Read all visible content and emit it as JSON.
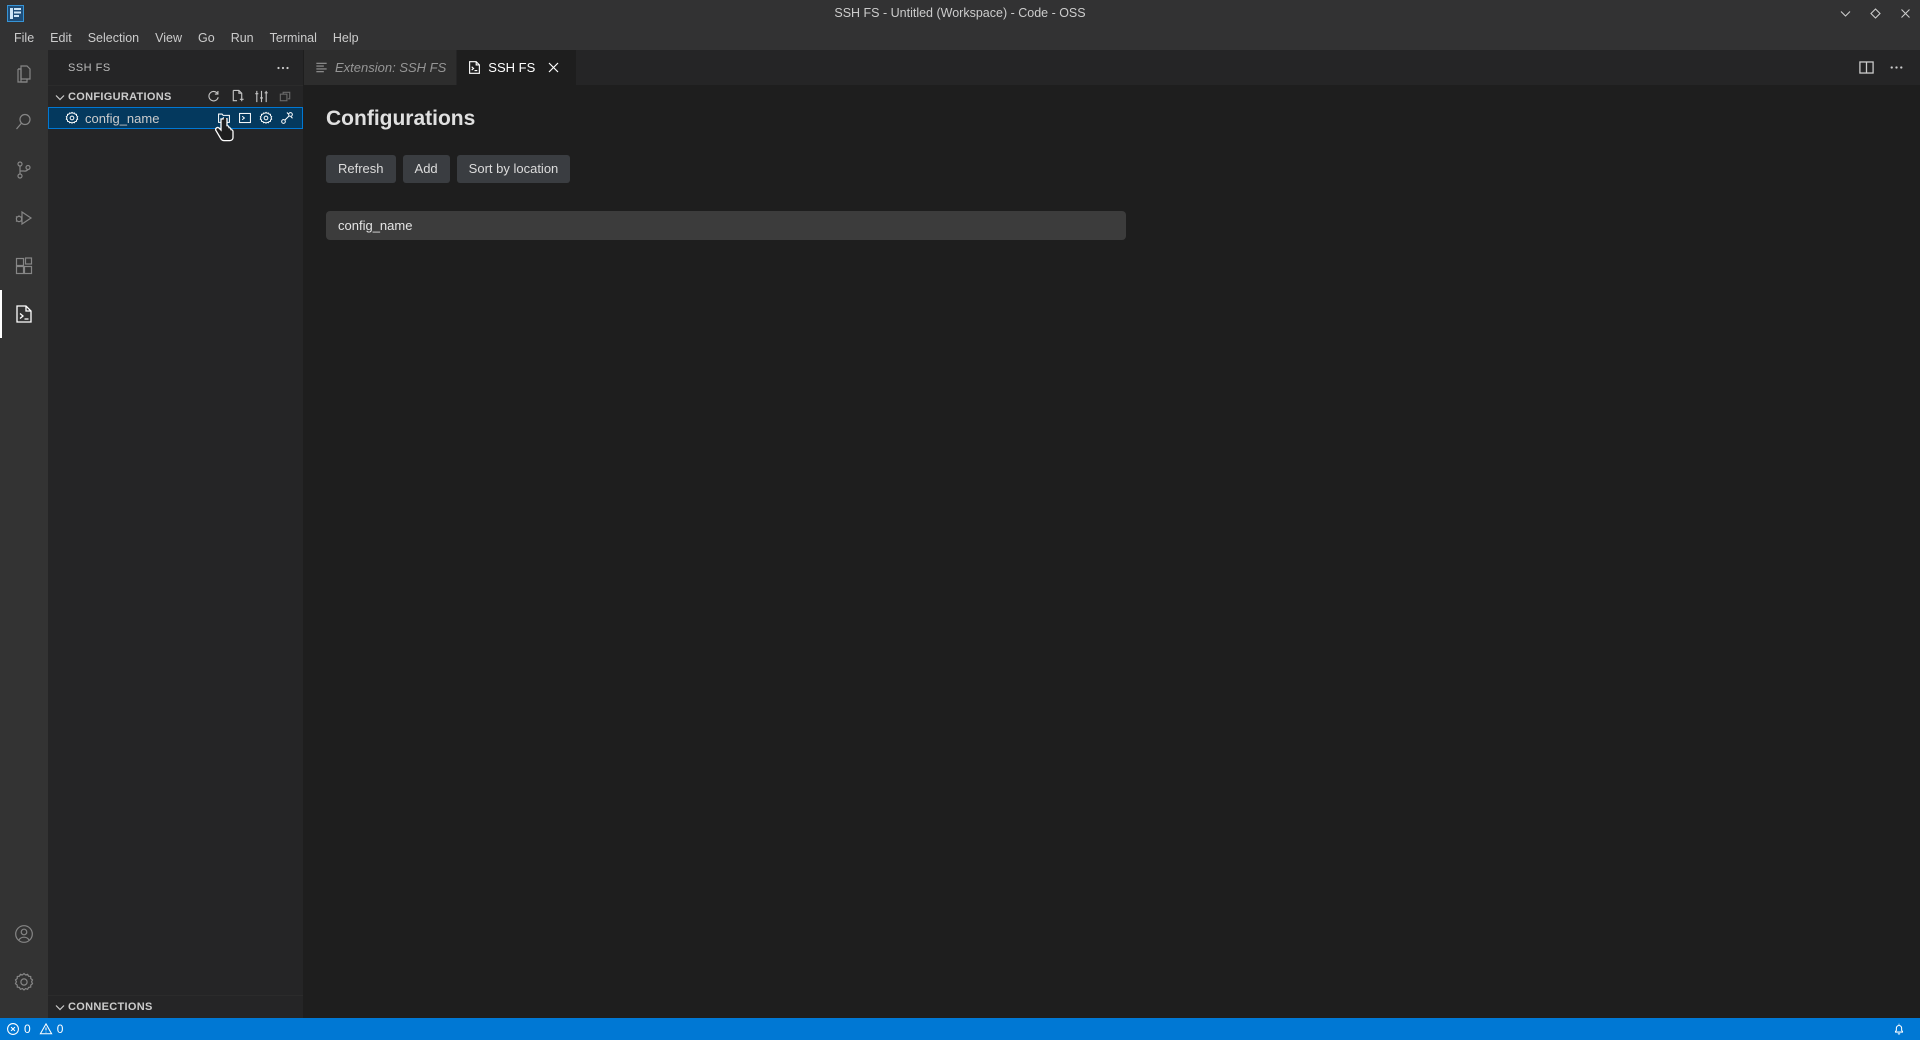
{
  "window": {
    "title": "SSH FS - Untitled (Workspace) - Code - OSS",
    "logo_icon": "code-oss-logo-icon",
    "controls": [
      {
        "name": "minimize",
        "label": "minimize-icon"
      },
      {
        "name": "maximize",
        "label": "maximize-icon"
      },
      {
        "name": "close",
        "label": "close-icon"
      }
    ]
  },
  "menubar": {
    "items": [
      {
        "label": "File"
      },
      {
        "label": "Edit"
      },
      {
        "label": "Selection"
      },
      {
        "label": "View"
      },
      {
        "label": "Go"
      },
      {
        "label": "Run"
      },
      {
        "label": "Terminal"
      },
      {
        "label": "Help"
      }
    ]
  },
  "activitybar": {
    "items": [
      {
        "name": "explorer",
        "icon": "files-icon",
        "active": false
      },
      {
        "name": "search",
        "icon": "search-icon",
        "active": false
      },
      {
        "name": "source-control",
        "icon": "source-control-icon",
        "active": false
      },
      {
        "name": "run-and-debug",
        "icon": "debug-icon",
        "active": false
      },
      {
        "name": "extensions",
        "icon": "extensions-icon",
        "active": false
      },
      {
        "name": "ssh-fs",
        "icon": "terminal-file-icon",
        "active": true
      }
    ],
    "bottom": [
      {
        "name": "accounts",
        "icon": "account-icon"
      },
      {
        "name": "manage",
        "icon": "gear-icon"
      }
    ]
  },
  "sidebar": {
    "title": "SSH FS",
    "more_actions_icon": "ellipsis-icon",
    "sections": [
      {
        "name": "configurations",
        "label": "CONFIGURATIONS",
        "expanded": true,
        "actions": [
          {
            "name": "refresh",
            "icon": "refresh-icon",
            "dim": false
          },
          {
            "name": "add-configuration",
            "icon": "new-file-icon",
            "dim": false
          },
          {
            "name": "settings",
            "icon": "sliders-icon",
            "dim": false
          },
          {
            "name": "collapse-all",
            "icon": "collapse-all-icon",
            "dim": true
          }
        ],
        "items": [
          {
            "label": "config_name",
            "icon": "gear-icon",
            "selected": true,
            "actions": [
              {
                "name": "add-to-workspace",
                "icon": "new-folder-icon"
              },
              {
                "name": "open-terminal",
                "icon": "terminal-icon"
              },
              {
                "name": "edit-configuration",
                "icon": "gear-icon"
              },
              {
                "name": "connect",
                "icon": "plug-icon"
              }
            ]
          }
        ]
      },
      {
        "name": "connections",
        "label": "CONNECTIONS",
        "expanded": true,
        "actions": [],
        "items": []
      }
    ]
  },
  "editor": {
    "tabs": [
      {
        "label": "Extension: SSH FS",
        "icon": "extension-icon",
        "active": false,
        "preview": true,
        "closable": false
      },
      {
        "label": "SSH FS",
        "icon": "terminal-file-icon",
        "active": true,
        "preview": false,
        "closable": true,
        "close_icon": "close-icon"
      }
    ],
    "actions": [
      {
        "name": "split-editor",
        "icon": "split-editor-icon"
      },
      {
        "name": "more-actions",
        "icon": "ellipsis-icon"
      }
    ],
    "page": {
      "title": "Configurations",
      "buttons": [
        {
          "name": "refresh-button",
          "label": "Refresh"
        },
        {
          "name": "add-button",
          "label": "Add"
        },
        {
          "name": "sort-by-location-button",
          "label": "Sort by location"
        }
      ],
      "configs": [
        {
          "label": "config_name"
        }
      ]
    }
  },
  "statusbar": {
    "errors_icon": "error-icon",
    "errors": "0",
    "warnings_icon": "warning-icon",
    "warnings": "0",
    "notifications_icon": "bell-icon"
  },
  "colors": {
    "accent": "#0078d4",
    "selection": "#04395e",
    "titlebar": "#323233",
    "sidebar": "#252526",
    "editor": "#1e1e1e",
    "activitybar": "#333333",
    "button": "#3a3d41",
    "card": "#3c3c3c"
  }
}
